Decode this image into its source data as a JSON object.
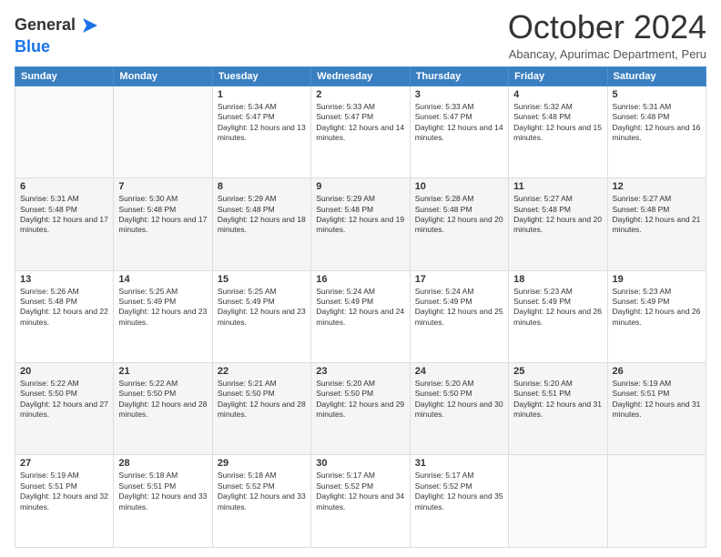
{
  "logo": {
    "general": "General",
    "blue": "Blue"
  },
  "header": {
    "month": "October 2024",
    "location": "Abancay, Apurimac Department, Peru"
  },
  "days_of_week": [
    "Sunday",
    "Monday",
    "Tuesday",
    "Wednesday",
    "Thursday",
    "Friday",
    "Saturday"
  ],
  "weeks": [
    [
      {
        "day": "",
        "sunrise": "",
        "sunset": "",
        "daylight": ""
      },
      {
        "day": "",
        "sunrise": "",
        "sunset": "",
        "daylight": ""
      },
      {
        "day": "1",
        "sunrise": "Sunrise: 5:34 AM",
        "sunset": "Sunset: 5:47 PM",
        "daylight": "Daylight: 12 hours and 13 minutes."
      },
      {
        "day": "2",
        "sunrise": "Sunrise: 5:33 AM",
        "sunset": "Sunset: 5:47 PM",
        "daylight": "Daylight: 12 hours and 14 minutes."
      },
      {
        "day": "3",
        "sunrise": "Sunrise: 5:33 AM",
        "sunset": "Sunset: 5:47 PM",
        "daylight": "Daylight: 12 hours and 14 minutes."
      },
      {
        "day": "4",
        "sunrise": "Sunrise: 5:32 AM",
        "sunset": "Sunset: 5:48 PM",
        "daylight": "Daylight: 12 hours and 15 minutes."
      },
      {
        "day": "5",
        "sunrise": "Sunrise: 5:31 AM",
        "sunset": "Sunset: 5:48 PM",
        "daylight": "Daylight: 12 hours and 16 minutes."
      }
    ],
    [
      {
        "day": "6",
        "sunrise": "Sunrise: 5:31 AM",
        "sunset": "Sunset: 5:48 PM",
        "daylight": "Daylight: 12 hours and 17 minutes."
      },
      {
        "day": "7",
        "sunrise": "Sunrise: 5:30 AM",
        "sunset": "Sunset: 5:48 PM",
        "daylight": "Daylight: 12 hours and 17 minutes."
      },
      {
        "day": "8",
        "sunrise": "Sunrise: 5:29 AM",
        "sunset": "Sunset: 5:48 PM",
        "daylight": "Daylight: 12 hours and 18 minutes."
      },
      {
        "day": "9",
        "sunrise": "Sunrise: 5:29 AM",
        "sunset": "Sunset: 5:48 PM",
        "daylight": "Daylight: 12 hours and 19 minutes."
      },
      {
        "day": "10",
        "sunrise": "Sunrise: 5:28 AM",
        "sunset": "Sunset: 5:48 PM",
        "daylight": "Daylight: 12 hours and 20 minutes."
      },
      {
        "day": "11",
        "sunrise": "Sunrise: 5:27 AM",
        "sunset": "Sunset: 5:48 PM",
        "daylight": "Daylight: 12 hours and 20 minutes."
      },
      {
        "day": "12",
        "sunrise": "Sunrise: 5:27 AM",
        "sunset": "Sunset: 5:48 PM",
        "daylight": "Daylight: 12 hours and 21 minutes."
      }
    ],
    [
      {
        "day": "13",
        "sunrise": "Sunrise: 5:26 AM",
        "sunset": "Sunset: 5:48 PM",
        "daylight": "Daylight: 12 hours and 22 minutes."
      },
      {
        "day": "14",
        "sunrise": "Sunrise: 5:25 AM",
        "sunset": "Sunset: 5:49 PM",
        "daylight": "Daylight: 12 hours and 23 minutes."
      },
      {
        "day": "15",
        "sunrise": "Sunrise: 5:25 AM",
        "sunset": "Sunset: 5:49 PM",
        "daylight": "Daylight: 12 hours and 23 minutes."
      },
      {
        "day": "16",
        "sunrise": "Sunrise: 5:24 AM",
        "sunset": "Sunset: 5:49 PM",
        "daylight": "Daylight: 12 hours and 24 minutes."
      },
      {
        "day": "17",
        "sunrise": "Sunrise: 5:24 AM",
        "sunset": "Sunset: 5:49 PM",
        "daylight": "Daylight: 12 hours and 25 minutes."
      },
      {
        "day": "18",
        "sunrise": "Sunrise: 5:23 AM",
        "sunset": "Sunset: 5:49 PM",
        "daylight": "Daylight: 12 hours and 26 minutes."
      },
      {
        "day": "19",
        "sunrise": "Sunrise: 5:23 AM",
        "sunset": "Sunset: 5:49 PM",
        "daylight": "Daylight: 12 hours and 26 minutes."
      }
    ],
    [
      {
        "day": "20",
        "sunrise": "Sunrise: 5:22 AM",
        "sunset": "Sunset: 5:50 PM",
        "daylight": "Daylight: 12 hours and 27 minutes."
      },
      {
        "day": "21",
        "sunrise": "Sunrise: 5:22 AM",
        "sunset": "Sunset: 5:50 PM",
        "daylight": "Daylight: 12 hours and 28 minutes."
      },
      {
        "day": "22",
        "sunrise": "Sunrise: 5:21 AM",
        "sunset": "Sunset: 5:50 PM",
        "daylight": "Daylight: 12 hours and 28 minutes."
      },
      {
        "day": "23",
        "sunrise": "Sunrise: 5:20 AM",
        "sunset": "Sunset: 5:50 PM",
        "daylight": "Daylight: 12 hours and 29 minutes."
      },
      {
        "day": "24",
        "sunrise": "Sunrise: 5:20 AM",
        "sunset": "Sunset: 5:50 PM",
        "daylight": "Daylight: 12 hours and 30 minutes."
      },
      {
        "day": "25",
        "sunrise": "Sunrise: 5:20 AM",
        "sunset": "Sunset: 5:51 PM",
        "daylight": "Daylight: 12 hours and 31 minutes."
      },
      {
        "day": "26",
        "sunrise": "Sunrise: 5:19 AM",
        "sunset": "Sunset: 5:51 PM",
        "daylight": "Daylight: 12 hours and 31 minutes."
      }
    ],
    [
      {
        "day": "27",
        "sunrise": "Sunrise: 5:19 AM",
        "sunset": "Sunset: 5:51 PM",
        "daylight": "Daylight: 12 hours and 32 minutes."
      },
      {
        "day": "28",
        "sunrise": "Sunrise: 5:18 AM",
        "sunset": "Sunset: 5:51 PM",
        "daylight": "Daylight: 12 hours and 33 minutes."
      },
      {
        "day": "29",
        "sunrise": "Sunrise: 5:18 AM",
        "sunset": "Sunset: 5:52 PM",
        "daylight": "Daylight: 12 hours and 33 minutes."
      },
      {
        "day": "30",
        "sunrise": "Sunrise: 5:17 AM",
        "sunset": "Sunset: 5:52 PM",
        "daylight": "Daylight: 12 hours and 34 minutes."
      },
      {
        "day": "31",
        "sunrise": "Sunrise: 5:17 AM",
        "sunset": "Sunset: 5:52 PM",
        "daylight": "Daylight: 12 hours and 35 minutes."
      },
      {
        "day": "",
        "sunrise": "",
        "sunset": "",
        "daylight": ""
      },
      {
        "day": "",
        "sunrise": "",
        "sunset": "",
        "daylight": ""
      }
    ]
  ]
}
